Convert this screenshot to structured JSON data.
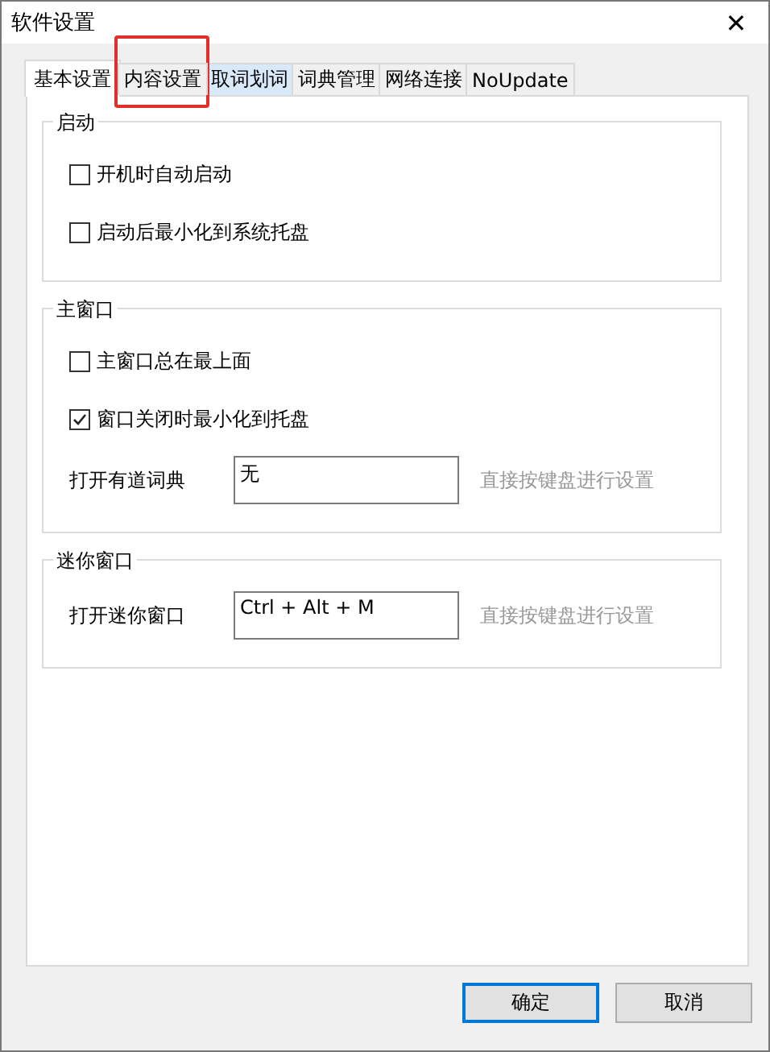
{
  "window": {
    "title": "软件设置",
    "close": "✕"
  },
  "tabs": [
    {
      "label": "基本设置",
      "selected": true,
      "highlighted": false,
      "annotated": false
    },
    {
      "label": "内容设置",
      "selected": false,
      "highlighted": false,
      "annotated": true
    },
    {
      "label": "取词划词",
      "selected": false,
      "highlighted": true,
      "annotated": false
    },
    {
      "label": "词典管理",
      "selected": false,
      "highlighted": false,
      "annotated": false
    },
    {
      "label": "网络连接",
      "selected": false,
      "highlighted": false,
      "annotated": false
    },
    {
      "label": "NoUpdate",
      "selected": false,
      "highlighted": false,
      "annotated": false
    }
  ],
  "groups": [
    {
      "title": "启动",
      "items": [
        {
          "kind": "checkbox",
          "label": "开机时自动启动",
          "checked": false
        },
        {
          "kind": "checkbox",
          "label": "启动后最小化到系统托盘",
          "checked": false
        }
      ]
    },
    {
      "title": "主窗口",
      "items": [
        {
          "kind": "checkbox",
          "label": "主窗口总在最上面",
          "checked": false
        },
        {
          "kind": "checkbox",
          "label": "窗口关闭时最小化到托盘",
          "checked": true
        },
        {
          "kind": "hotkey",
          "label": "打开有道词典",
          "value": "无",
          "hint": "直接按键盘进行设置"
        }
      ]
    },
    {
      "title": "迷你窗口",
      "items": [
        {
          "kind": "hotkey",
          "label": "打开迷你窗口",
          "value": "Ctrl + Alt + M",
          "hint": "直接按键盘进行设置"
        }
      ]
    }
  ],
  "buttons": [
    {
      "label": "确定",
      "default": true
    },
    {
      "label": "取消",
      "default": false
    }
  ]
}
